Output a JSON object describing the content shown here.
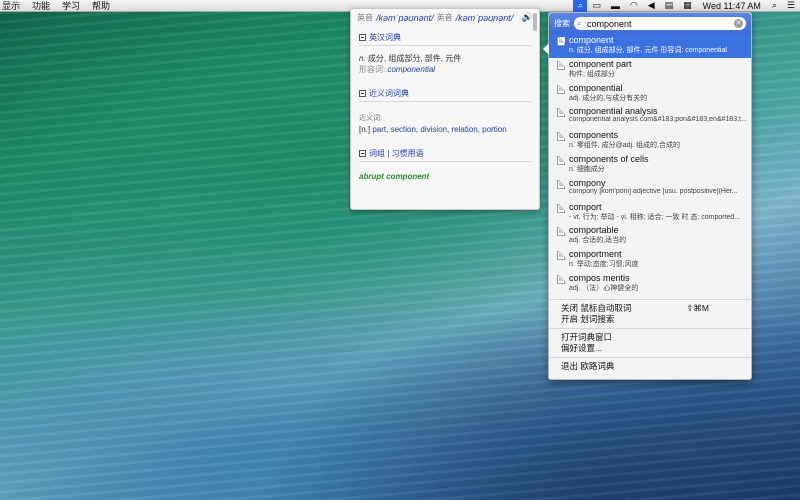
{
  "menubar": {
    "left": [
      "显示",
      "功能",
      "学习",
      "帮助"
    ],
    "clock": "Wed 11:47 AM",
    "status_icons": [
      "dict-icon",
      "display-icon",
      "battery-icon",
      "wifi-icon",
      "volume-icon",
      "flag-icon",
      "user-icon",
      "list-icon",
      "spotlight-icon",
      "notification-icon"
    ]
  },
  "popover": {
    "pron_uk_label": "英音",
    "pron_uk": "/kəmˈpəʊnənt/",
    "pron_us_label": "英音",
    "pron_us": "/kəmˈpəʊnənt/",
    "section1_title": "英汉词典",
    "def_pos": "n.",
    "def_text": " 成分, 组成部分, 部件, 元件",
    "adj_label": "形容词: ",
    "adj_word": "componential",
    "section2_title": "近义词词典",
    "syn_label": "近义词:",
    "syn_tag": "[n.] ",
    "syn_list": "part, section, division, relation, portion",
    "section3_title": "词组 | 习惯用语",
    "phrase": "abrupt component"
  },
  "panel": {
    "search_label": "搜索",
    "search_value": "component",
    "results": [
      {
        "word": "component",
        "def": "n. 成分, 组成部分, 部件, 元件 形容词:   componential"
      },
      {
        "word": "component part",
        "def": "构件; 组成部分"
      },
      {
        "word": "componential",
        "def": "adj. 成分的,与成分有关的"
      },
      {
        "word": "componential analysis",
        "def": "componential analysis com&#183;pon&#183;en&#183;t..."
      },
      {
        "word": "components",
        "def": "n. 零组件, 成分@adj. 组成的,合成的"
      },
      {
        "word": "components of cells",
        "def": "n. 细胞成分"
      },
      {
        "word": "compony",
        "def": "compony [kom'poni] adjective      [usu. postpositive](Her..."
      },
      {
        "word": "comport",
        "def": "- vt. 行为; 举动 - vi. 相称; 适合; 一致 时 态:    comported..."
      },
      {
        "word": "comportable",
        "def": "adj. 合适的,适当的"
      },
      {
        "word": "comportment",
        "def": "n. 举动;态度;习惯;风度"
      },
      {
        "word": "compos mentis",
        "def": "adj. （法）心神健全的"
      }
    ],
    "menu1": [
      {
        "label": "关闭 鼠标自动取词",
        "shortcut": "⇧⌘M"
      },
      {
        "label": "开启 划词搜索",
        "shortcut": ""
      }
    ],
    "menu2": [
      {
        "label": "打开词典窗口"
      },
      {
        "label": "偏好设置..."
      }
    ],
    "menu3": [
      {
        "label": "退出 欧路词典"
      }
    ]
  }
}
